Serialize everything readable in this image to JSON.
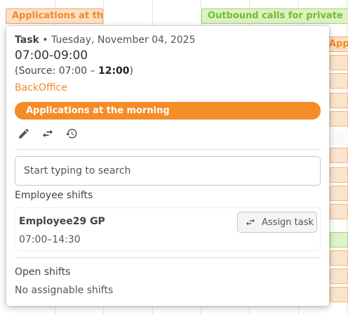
{
  "background": {
    "tasks": [
      {
        "label": "Applications at the m",
        "color": "#f08a24"
      },
      {
        "label": "Outbound calls for private",
        "color": "#6fbf2e"
      },
      {
        "label": "Appl",
        "color": "#f08a24"
      }
    ]
  },
  "popup": {
    "kind": "Task",
    "separator": " • ",
    "date": "Tuesday, November 04, 2025",
    "time_range": "07:00-09:00",
    "source_prefix": "(Source: 07:00 – ",
    "source_end": "12:00",
    "source_suffix": ")",
    "department": "BackOffice",
    "task_name": "Applications at the morning",
    "task_color": "#f58c2a",
    "actions": [
      {
        "icon": "edit-icon"
      },
      {
        "icon": "swap-icon"
      },
      {
        "icon": "history-icon"
      }
    ],
    "search": {
      "placeholder": "Start typing to search",
      "value": ""
    },
    "employee_shifts": {
      "title": "Employee shifts",
      "items": [
        {
          "name": "Employee29 GP",
          "time": "07:00–14:30",
          "action_label": "Assign task",
          "action_icon": "swap-icon"
        }
      ]
    },
    "open_shifts": {
      "title": "Open shifts",
      "empty_text": "No assignable shifts"
    }
  }
}
